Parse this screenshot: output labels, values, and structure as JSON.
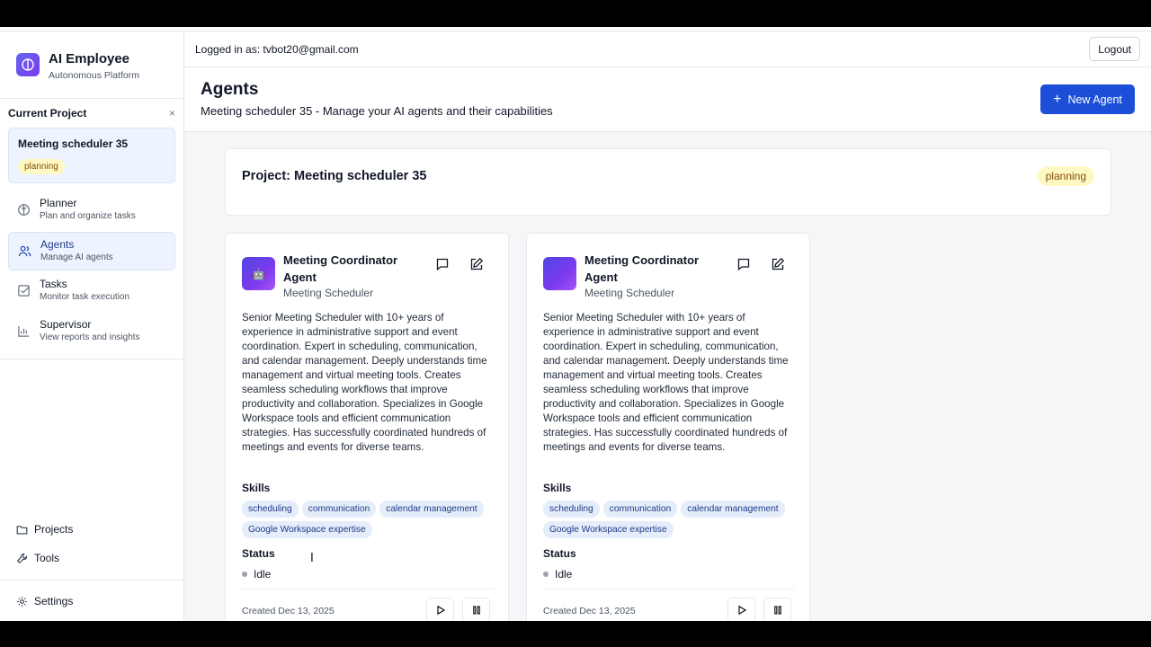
{
  "app": {
    "title": "AI Employee",
    "subtitle": "Autonomous Platform"
  },
  "current_project": {
    "heading": "Current Project",
    "close_glyph": "×",
    "name": "Meeting scheduler 35",
    "status": "planning"
  },
  "nav": [
    {
      "label": "Planner",
      "desc": "Plan and organize tasks",
      "icon": "brain-icon",
      "active": false
    },
    {
      "label": "Agents",
      "desc": "Manage AI agents",
      "icon": "users-icon",
      "active": true
    },
    {
      "label": "Tasks",
      "desc": "Monitor task execution",
      "icon": "check-square-icon",
      "active": false
    },
    {
      "label": "Supervisor",
      "desc": "View reports and insights",
      "icon": "bar-chart-icon",
      "active": false
    }
  ],
  "bottom_nav": {
    "projects": "Projects",
    "tools": "Tools",
    "settings": "Settings"
  },
  "topbar": {
    "logged_in": "Logged in as: tvbot20@gmail.com",
    "logout": "Logout"
  },
  "page": {
    "title": "Agents",
    "subtitle": "Meeting scheduler 35 - Manage your AI agents and their capabilities",
    "new_agent": "New Agent"
  },
  "project_card": {
    "title": "Project: Meeting scheduler 35",
    "status": "planning"
  },
  "agents": [
    {
      "name": "Meeting Coordinator Agent",
      "role": "Meeting Scheduler",
      "avatar_glyph": "🤖",
      "description": "Senior Meeting Scheduler with 10+ years of experience in administrative support and event coordination. Expert in scheduling, communication, and calendar management. Deeply understands time management and virtual meeting tools. Creates seamless scheduling workflows that improve productivity and collaboration. Specializes in Google Workspace tools and efficient communication strategies. Has successfully coordinated hundreds of meetings and events for diverse teams.",
      "skills_title": "Skills",
      "skills": [
        "scheduling",
        "communication",
        "calendar management",
        "Google Workspace expertise"
      ],
      "status_title": "Status",
      "status": "Idle",
      "created": "Created Dec 13, 2025"
    },
    {
      "name": "Meeting Coordinator Agent",
      "role": "Meeting Scheduler",
      "avatar_glyph": "",
      "description": "Senior Meeting Scheduler with 10+ years of experience in administrative support and event coordination. Expert in scheduling, communication, and calendar management. Deeply understands time management and virtual meeting tools. Creates seamless scheduling workflows that improve productivity and collaboration. Specializes in Google Workspace tools and efficient communication strategies. Has successfully coordinated hundreds of meetings and events for diverse teams.",
      "skills_title": "Skills",
      "skills": [
        "scheduling",
        "communication",
        "calendar management",
        "Google Workspace expertise"
      ],
      "status_title": "Status",
      "status": "Idle",
      "created": "Created Dec 13, 2025"
    }
  ],
  "colors": {
    "primary": "#1d4ed8",
    "active_nav_bg": "#eef4ff",
    "planning_badge_bg": "#fef9c3",
    "skill_bg": "#e5edfa"
  }
}
